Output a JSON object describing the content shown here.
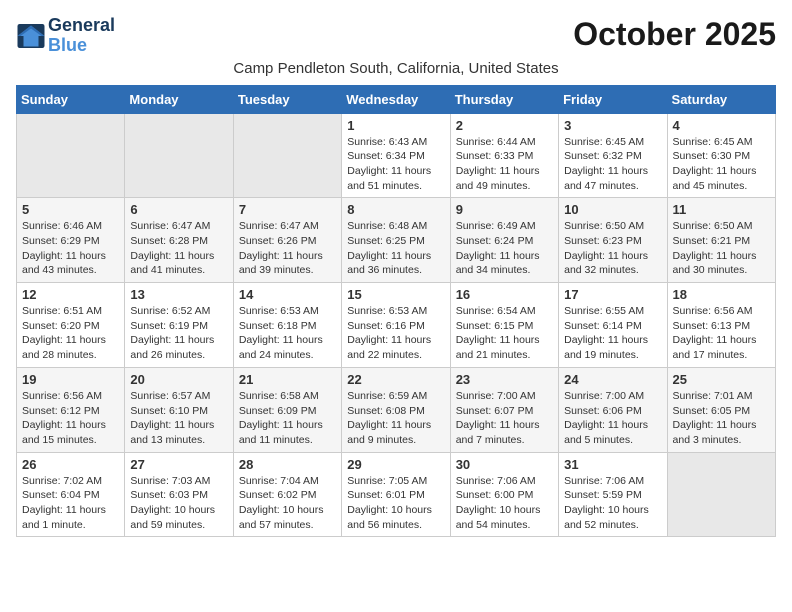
{
  "logo": {
    "text_general": "General",
    "text_blue": "Blue"
  },
  "header": {
    "month_title": "October 2025",
    "location": "Camp Pendleton South, California, United States"
  },
  "weekdays": [
    "Sunday",
    "Monday",
    "Tuesday",
    "Wednesday",
    "Thursday",
    "Friday",
    "Saturday"
  ],
  "weeks": [
    [
      {
        "day": "",
        "info": ""
      },
      {
        "day": "",
        "info": ""
      },
      {
        "day": "",
        "info": ""
      },
      {
        "day": "1",
        "info": "Sunrise: 6:43 AM\nSunset: 6:34 PM\nDaylight: 11 hours\nand 51 minutes."
      },
      {
        "day": "2",
        "info": "Sunrise: 6:44 AM\nSunset: 6:33 PM\nDaylight: 11 hours\nand 49 minutes."
      },
      {
        "day": "3",
        "info": "Sunrise: 6:45 AM\nSunset: 6:32 PM\nDaylight: 11 hours\nand 47 minutes."
      },
      {
        "day": "4",
        "info": "Sunrise: 6:45 AM\nSunset: 6:30 PM\nDaylight: 11 hours\nand 45 minutes."
      }
    ],
    [
      {
        "day": "5",
        "info": "Sunrise: 6:46 AM\nSunset: 6:29 PM\nDaylight: 11 hours\nand 43 minutes."
      },
      {
        "day": "6",
        "info": "Sunrise: 6:47 AM\nSunset: 6:28 PM\nDaylight: 11 hours\nand 41 minutes."
      },
      {
        "day": "7",
        "info": "Sunrise: 6:47 AM\nSunset: 6:26 PM\nDaylight: 11 hours\nand 39 minutes."
      },
      {
        "day": "8",
        "info": "Sunrise: 6:48 AM\nSunset: 6:25 PM\nDaylight: 11 hours\nand 36 minutes."
      },
      {
        "day": "9",
        "info": "Sunrise: 6:49 AM\nSunset: 6:24 PM\nDaylight: 11 hours\nand 34 minutes."
      },
      {
        "day": "10",
        "info": "Sunrise: 6:50 AM\nSunset: 6:23 PM\nDaylight: 11 hours\nand 32 minutes."
      },
      {
        "day": "11",
        "info": "Sunrise: 6:50 AM\nSunset: 6:21 PM\nDaylight: 11 hours\nand 30 minutes."
      }
    ],
    [
      {
        "day": "12",
        "info": "Sunrise: 6:51 AM\nSunset: 6:20 PM\nDaylight: 11 hours\nand 28 minutes."
      },
      {
        "day": "13",
        "info": "Sunrise: 6:52 AM\nSunset: 6:19 PM\nDaylight: 11 hours\nand 26 minutes."
      },
      {
        "day": "14",
        "info": "Sunrise: 6:53 AM\nSunset: 6:18 PM\nDaylight: 11 hours\nand 24 minutes."
      },
      {
        "day": "15",
        "info": "Sunrise: 6:53 AM\nSunset: 6:16 PM\nDaylight: 11 hours\nand 22 minutes."
      },
      {
        "day": "16",
        "info": "Sunrise: 6:54 AM\nSunset: 6:15 PM\nDaylight: 11 hours\nand 21 minutes."
      },
      {
        "day": "17",
        "info": "Sunrise: 6:55 AM\nSunset: 6:14 PM\nDaylight: 11 hours\nand 19 minutes."
      },
      {
        "day": "18",
        "info": "Sunrise: 6:56 AM\nSunset: 6:13 PM\nDaylight: 11 hours\nand 17 minutes."
      }
    ],
    [
      {
        "day": "19",
        "info": "Sunrise: 6:56 AM\nSunset: 6:12 PM\nDaylight: 11 hours\nand 15 minutes."
      },
      {
        "day": "20",
        "info": "Sunrise: 6:57 AM\nSunset: 6:10 PM\nDaylight: 11 hours\nand 13 minutes."
      },
      {
        "day": "21",
        "info": "Sunrise: 6:58 AM\nSunset: 6:09 PM\nDaylight: 11 hours\nand 11 minutes."
      },
      {
        "day": "22",
        "info": "Sunrise: 6:59 AM\nSunset: 6:08 PM\nDaylight: 11 hours\nand 9 minutes."
      },
      {
        "day": "23",
        "info": "Sunrise: 7:00 AM\nSunset: 6:07 PM\nDaylight: 11 hours\nand 7 minutes."
      },
      {
        "day": "24",
        "info": "Sunrise: 7:00 AM\nSunset: 6:06 PM\nDaylight: 11 hours\nand 5 minutes."
      },
      {
        "day": "25",
        "info": "Sunrise: 7:01 AM\nSunset: 6:05 PM\nDaylight: 11 hours\nand 3 minutes."
      }
    ],
    [
      {
        "day": "26",
        "info": "Sunrise: 7:02 AM\nSunset: 6:04 PM\nDaylight: 11 hours\nand 1 minute."
      },
      {
        "day": "27",
        "info": "Sunrise: 7:03 AM\nSunset: 6:03 PM\nDaylight: 10 hours\nand 59 minutes."
      },
      {
        "day": "28",
        "info": "Sunrise: 7:04 AM\nSunset: 6:02 PM\nDaylight: 10 hours\nand 57 minutes."
      },
      {
        "day": "29",
        "info": "Sunrise: 7:05 AM\nSunset: 6:01 PM\nDaylight: 10 hours\nand 56 minutes."
      },
      {
        "day": "30",
        "info": "Sunrise: 7:06 AM\nSunset: 6:00 PM\nDaylight: 10 hours\nand 54 minutes."
      },
      {
        "day": "31",
        "info": "Sunrise: 7:06 AM\nSunset: 5:59 PM\nDaylight: 10 hours\nand 52 minutes."
      },
      {
        "day": "",
        "info": ""
      }
    ]
  ]
}
